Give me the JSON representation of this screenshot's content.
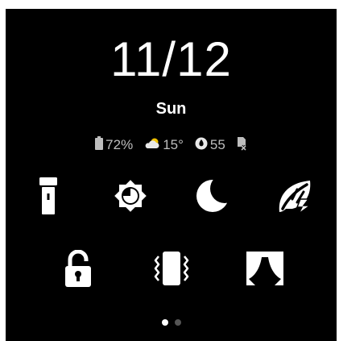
{
  "clock": {
    "date": "11/12",
    "weekday": "Sun"
  },
  "status": {
    "battery": {
      "icon": "battery-icon",
      "value": "72%",
      "level": 0.72
    },
    "weather": {
      "icon": "partly-cloudy-icon",
      "value": "15°"
    },
    "air_quality": {
      "icon": "leaf-drop-icon",
      "value": "55"
    },
    "sim": {
      "icon": "no-sim-icon"
    }
  },
  "tiles": [
    {
      "name": "flashlight",
      "icon": "flashlight-icon"
    },
    {
      "name": "brightness",
      "icon": "brightness-icon"
    },
    {
      "name": "do-not-disturb",
      "icon": "moon-icon"
    },
    {
      "name": "power-saving",
      "icon": "leaf-bolt-icon"
    },
    {
      "name": "screen-lock",
      "icon": "unlock-icon"
    },
    {
      "name": "vibration",
      "icon": "vibrate-icon"
    },
    {
      "name": "theater-mode",
      "icon": "theater-curtain-icon"
    }
  ],
  "pager": {
    "pages": 2,
    "current": 1
  },
  "colors": {
    "background": "#000000",
    "foreground": "#ffffff",
    "secondary": "#bdbdbd",
    "dot_inactive": "#555555"
  }
}
